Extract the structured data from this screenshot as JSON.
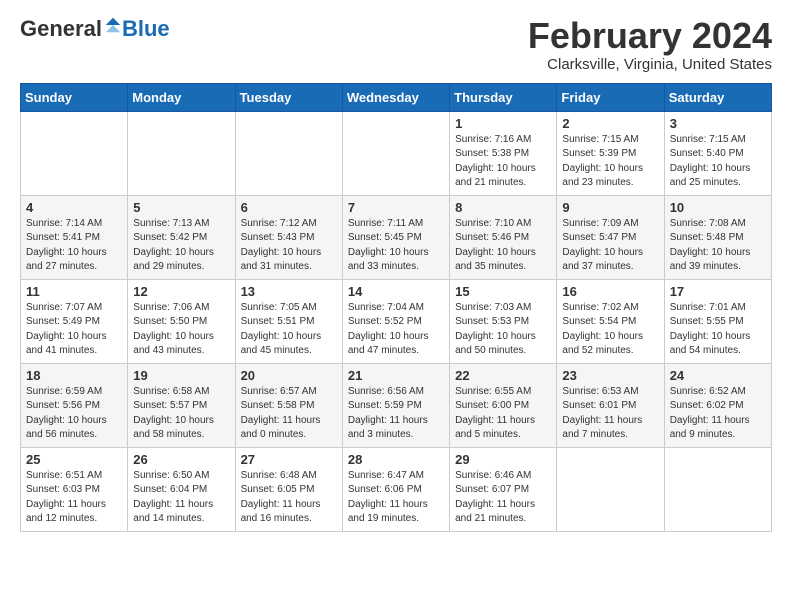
{
  "logo": {
    "general": "General",
    "blue": "Blue"
  },
  "header": {
    "month": "February 2024",
    "location": "Clarksville, Virginia, United States"
  },
  "weekdays": [
    "Sunday",
    "Monday",
    "Tuesday",
    "Wednesday",
    "Thursday",
    "Friday",
    "Saturday"
  ],
  "weeks": [
    [
      {
        "day": "",
        "info": ""
      },
      {
        "day": "",
        "info": ""
      },
      {
        "day": "",
        "info": ""
      },
      {
        "day": "",
        "info": ""
      },
      {
        "day": "1",
        "info": "Sunrise: 7:16 AM\nSunset: 5:38 PM\nDaylight: 10 hours\nand 21 minutes."
      },
      {
        "day": "2",
        "info": "Sunrise: 7:15 AM\nSunset: 5:39 PM\nDaylight: 10 hours\nand 23 minutes."
      },
      {
        "day": "3",
        "info": "Sunrise: 7:15 AM\nSunset: 5:40 PM\nDaylight: 10 hours\nand 25 minutes."
      }
    ],
    [
      {
        "day": "4",
        "info": "Sunrise: 7:14 AM\nSunset: 5:41 PM\nDaylight: 10 hours\nand 27 minutes."
      },
      {
        "day": "5",
        "info": "Sunrise: 7:13 AM\nSunset: 5:42 PM\nDaylight: 10 hours\nand 29 minutes."
      },
      {
        "day": "6",
        "info": "Sunrise: 7:12 AM\nSunset: 5:43 PM\nDaylight: 10 hours\nand 31 minutes."
      },
      {
        "day": "7",
        "info": "Sunrise: 7:11 AM\nSunset: 5:45 PM\nDaylight: 10 hours\nand 33 minutes."
      },
      {
        "day": "8",
        "info": "Sunrise: 7:10 AM\nSunset: 5:46 PM\nDaylight: 10 hours\nand 35 minutes."
      },
      {
        "day": "9",
        "info": "Sunrise: 7:09 AM\nSunset: 5:47 PM\nDaylight: 10 hours\nand 37 minutes."
      },
      {
        "day": "10",
        "info": "Sunrise: 7:08 AM\nSunset: 5:48 PM\nDaylight: 10 hours\nand 39 minutes."
      }
    ],
    [
      {
        "day": "11",
        "info": "Sunrise: 7:07 AM\nSunset: 5:49 PM\nDaylight: 10 hours\nand 41 minutes."
      },
      {
        "day": "12",
        "info": "Sunrise: 7:06 AM\nSunset: 5:50 PM\nDaylight: 10 hours\nand 43 minutes."
      },
      {
        "day": "13",
        "info": "Sunrise: 7:05 AM\nSunset: 5:51 PM\nDaylight: 10 hours\nand 45 minutes."
      },
      {
        "day": "14",
        "info": "Sunrise: 7:04 AM\nSunset: 5:52 PM\nDaylight: 10 hours\nand 47 minutes."
      },
      {
        "day": "15",
        "info": "Sunrise: 7:03 AM\nSunset: 5:53 PM\nDaylight: 10 hours\nand 50 minutes."
      },
      {
        "day": "16",
        "info": "Sunrise: 7:02 AM\nSunset: 5:54 PM\nDaylight: 10 hours\nand 52 minutes."
      },
      {
        "day": "17",
        "info": "Sunrise: 7:01 AM\nSunset: 5:55 PM\nDaylight: 10 hours\nand 54 minutes."
      }
    ],
    [
      {
        "day": "18",
        "info": "Sunrise: 6:59 AM\nSunset: 5:56 PM\nDaylight: 10 hours\nand 56 minutes."
      },
      {
        "day": "19",
        "info": "Sunrise: 6:58 AM\nSunset: 5:57 PM\nDaylight: 10 hours\nand 58 minutes."
      },
      {
        "day": "20",
        "info": "Sunrise: 6:57 AM\nSunset: 5:58 PM\nDaylight: 11 hours\nand 0 minutes."
      },
      {
        "day": "21",
        "info": "Sunrise: 6:56 AM\nSunset: 5:59 PM\nDaylight: 11 hours\nand 3 minutes."
      },
      {
        "day": "22",
        "info": "Sunrise: 6:55 AM\nSunset: 6:00 PM\nDaylight: 11 hours\nand 5 minutes."
      },
      {
        "day": "23",
        "info": "Sunrise: 6:53 AM\nSunset: 6:01 PM\nDaylight: 11 hours\nand 7 minutes."
      },
      {
        "day": "24",
        "info": "Sunrise: 6:52 AM\nSunset: 6:02 PM\nDaylight: 11 hours\nand 9 minutes."
      }
    ],
    [
      {
        "day": "25",
        "info": "Sunrise: 6:51 AM\nSunset: 6:03 PM\nDaylight: 11 hours\nand 12 minutes."
      },
      {
        "day": "26",
        "info": "Sunrise: 6:50 AM\nSunset: 6:04 PM\nDaylight: 11 hours\nand 14 minutes."
      },
      {
        "day": "27",
        "info": "Sunrise: 6:48 AM\nSunset: 6:05 PM\nDaylight: 11 hours\nand 16 minutes."
      },
      {
        "day": "28",
        "info": "Sunrise: 6:47 AM\nSunset: 6:06 PM\nDaylight: 11 hours\nand 19 minutes."
      },
      {
        "day": "29",
        "info": "Sunrise: 6:46 AM\nSunset: 6:07 PM\nDaylight: 11 hours\nand 21 minutes."
      },
      {
        "day": "",
        "info": ""
      },
      {
        "day": "",
        "info": ""
      }
    ]
  ]
}
